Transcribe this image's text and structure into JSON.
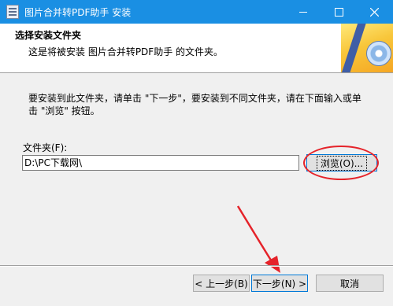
{
  "window": {
    "title": "图片合并转PDF助手 安装",
    "accent": "#1a8fe3"
  },
  "header": {
    "title": "选择安装文件夹",
    "subtitle": "这是将被安装 图片合并转PDF助手 的文件夹。"
  },
  "body": {
    "instruction_line1": "要安装到此文件夹，请单击 \"下一步\"，要安装到不同文件夹，请在下面输入或单",
    "instruction_line2": "击 \"浏览\" 按钮。",
    "folder_label": "文件夹(F):",
    "folder_value": "D:\\PC下载网\\",
    "browse_label": "浏览(O)..."
  },
  "footer": {
    "back_label": "< 上一步(B)",
    "next_label": "下一步(N) >",
    "cancel_label": "取消"
  },
  "annotation_color": "#e5232a"
}
